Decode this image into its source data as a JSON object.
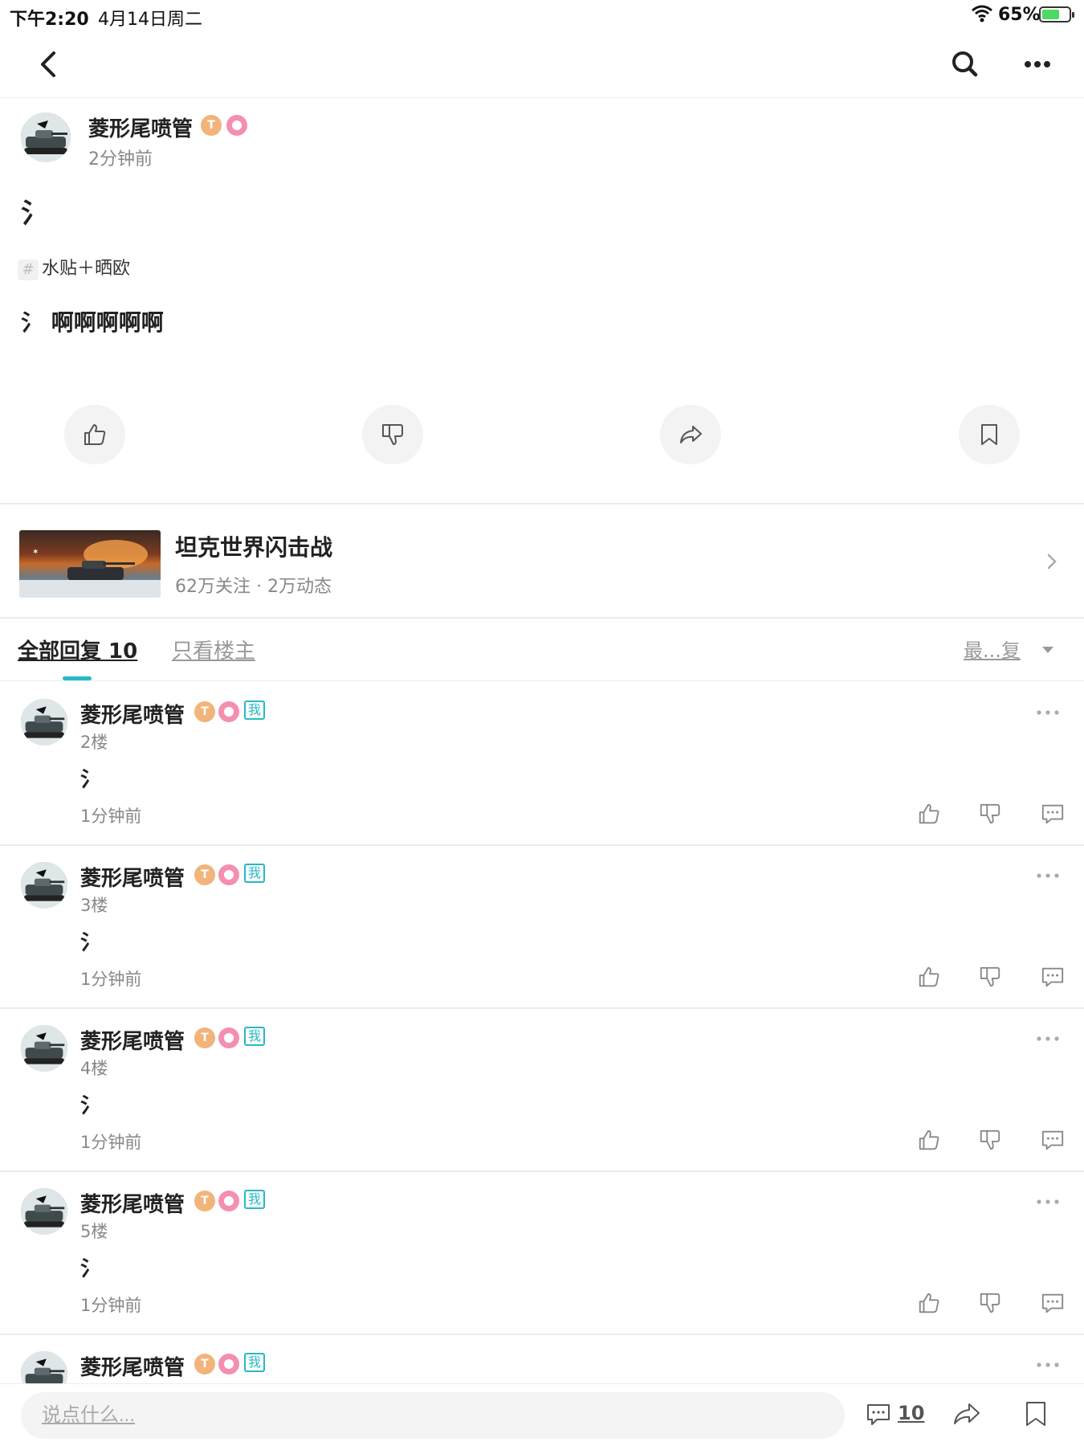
{
  "status_bar": {
    "time": "下午2:20",
    "date": "4月14日周二",
    "battery_percent": "65%",
    "battery_level": 0.65,
    "battery_color": "#4cd964"
  },
  "nav": {
    "back_icon": "chevron-left-icon",
    "search_icon": "search-icon",
    "more_icon": "more-horizontal-icon"
  },
  "post": {
    "author": "菱形尾喷管",
    "badge_t": "T",
    "time": "2分钟前",
    "title": "氵",
    "topic": "水贴＋晒欧",
    "topic_hash": "#",
    "body": "氵 啊啊啊啊啊"
  },
  "actions": [
    "like-icon",
    "dislike-icon",
    "share-icon",
    "bookmark-icon"
  ],
  "game": {
    "name": "坦克世界闪击战",
    "stats": "62万关注 · 2万动态"
  },
  "tabs": {
    "all_replies": "全部回复 10",
    "op_only": "只看楼主",
    "sort": "最...复"
  },
  "replies": [
    {
      "author": "菱形尾喷管",
      "badge_t": "T",
      "badge_me": "我",
      "floor": "2楼",
      "content": "氵",
      "time": "1分钟前"
    },
    {
      "author": "菱形尾喷管",
      "badge_t": "T",
      "badge_me": "我",
      "floor": "3楼",
      "content": "氵",
      "time": "1分钟前"
    },
    {
      "author": "菱形尾喷管",
      "badge_t": "T",
      "badge_me": "我",
      "floor": "4楼",
      "content": "氵",
      "time": "1分钟前"
    },
    {
      "author": "菱形尾喷管",
      "badge_t": "T",
      "badge_me": "我",
      "floor": "5楼",
      "content": "氵",
      "time": "1分钟前"
    },
    {
      "author": "菱形尾喷管",
      "badge_t": "T",
      "badge_me": "我",
      "floor": "",
      "content": "",
      "time": ""
    }
  ],
  "bottom_bar": {
    "placeholder": "说点什么...",
    "comment_count": "10"
  },
  "colors": {
    "accent": "#26b9c8",
    "badge_gold": "#f2b47a",
    "badge_pink": "#f48fb1"
  }
}
